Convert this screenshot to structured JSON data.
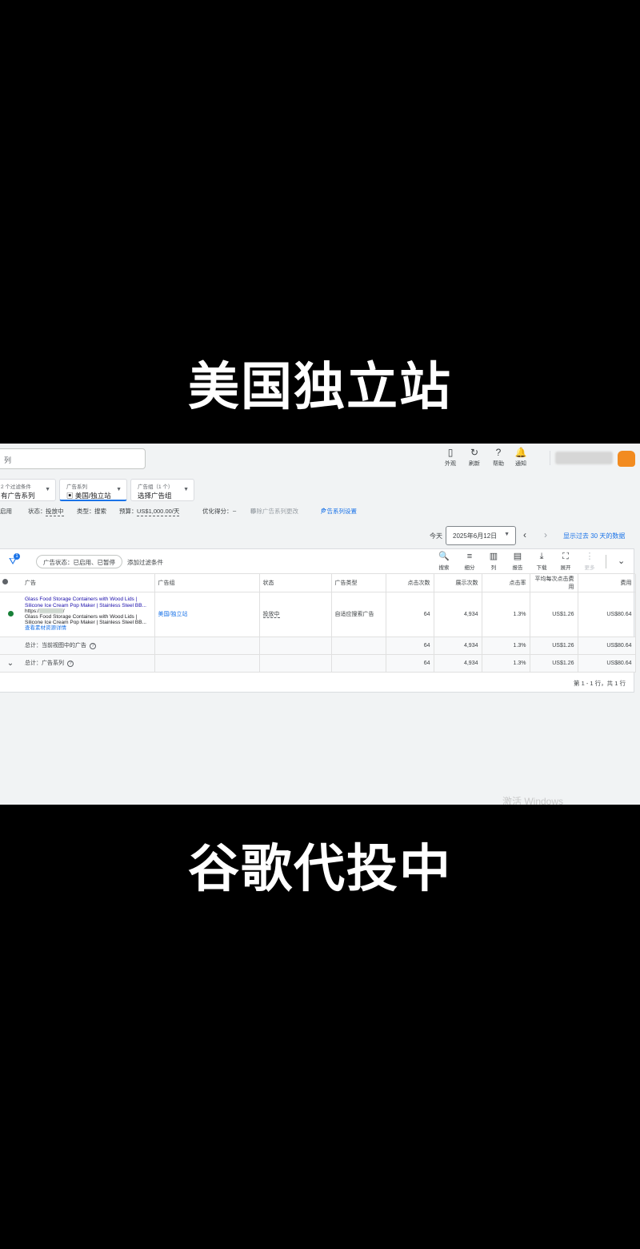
{
  "captions": {
    "top": "美国独立站",
    "bottom": "谷歌代投中"
  },
  "header": {
    "search_placeholder": "列",
    "icons": [
      {
        "icon": "appearance-icon",
        "glyph": "▯",
        "label": "外观"
      },
      {
        "icon": "refresh-icon",
        "glyph": "↻",
        "label": "刷新"
      },
      {
        "icon": "help-icon",
        "glyph": "?",
        "label": "帮助"
      },
      {
        "icon": "bell-icon",
        "glyph": "🔔",
        "label": "通知"
      }
    ]
  },
  "selectors": {
    "filter": {
      "label": "2 个过滤条件",
      "value": "有广告系列"
    },
    "campaign": {
      "label": "广告系列",
      "value": "美国/独立站"
    },
    "adgroup": {
      "label": "广告组（1 个）",
      "value": "选择广告组"
    }
  },
  "info": {
    "enabled": "启用",
    "status_label": "状态：",
    "status_value": "投放中",
    "type_label": "类型：",
    "type_value": "搜索",
    "budget_label": "预算：",
    "budget_value": "US$1,000.00/天",
    "score_label": "优化得分：",
    "score_value": "–",
    "changes": "移除广告系列更改",
    "settings": "广告系列设置"
  },
  "date": {
    "today": "今天",
    "picked": "2025年6月12日",
    "range_link": "显示过去 30 天的数据"
  },
  "filter_bar": {
    "badge": "1",
    "chip": "广告状态：已启用、已暂停",
    "add": "添加过滤条件",
    "tools": [
      {
        "icon": "search-icon",
        "glyph": "🔍",
        "label": "搜索"
      },
      {
        "icon": "segment-icon",
        "glyph": "≡",
        "label": "细分"
      },
      {
        "icon": "columns-icon",
        "glyph": "▥",
        "label": "列"
      },
      {
        "icon": "report-icon",
        "glyph": "▤",
        "label": "报告"
      },
      {
        "icon": "download-icon",
        "glyph": "⤓",
        "label": "下载"
      },
      {
        "icon": "expand-icon",
        "glyph": "⛶",
        "label": "展开"
      },
      {
        "icon": "more-icon",
        "glyph": "⋮",
        "label": "更多"
      }
    ]
  },
  "table": {
    "headers": [
      "广告",
      "广告组",
      "状态",
      "广告类型",
      "点击次数",
      "展示次数",
      "点击率",
      "平均每次点击费用",
      "费用"
    ],
    "row": {
      "headline_1": "Glass Food Storage Containers with Wood Lids |",
      "headline_2": "Silicone Ice Cream Pop Maker | Stainless Steel BB...",
      "url_prefix": "https:/",
      "url_suffix": "/",
      "desc_1": "Glass Food Storage Containers with Wood Lids |",
      "desc_2": "Silicone Ice Cream Pop Maker | Stainless Steel BB...",
      "detail_link": "查看素材资源详情",
      "adgroup": "美国/独立站",
      "status": "投放中",
      "ad_type": "自适应搜索广告",
      "clicks": "64",
      "impressions": "4,934",
      "ctr": "1.3%",
      "avg_cpc": "US$1.26",
      "cost": "US$80.64"
    },
    "total_view": {
      "label": "总计：当前视图中的广告",
      "clicks": "64",
      "impressions": "4,934",
      "ctr": "1.3%",
      "avg_cpc": "US$1.26",
      "cost": "US$80.64"
    },
    "total_campaign": {
      "label": "总计：广告系列",
      "clicks": "64",
      "impressions": "4,934",
      "ctr": "1.3%",
      "avg_cpc": "US$1.26",
      "cost": "US$80.64"
    },
    "pagination": "第 1 - 1 行，共 1 行"
  },
  "watermark": "激活 Windows"
}
